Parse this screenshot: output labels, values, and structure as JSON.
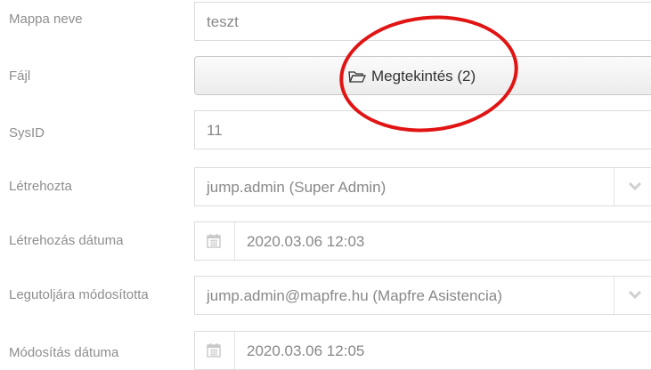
{
  "form": {
    "folder_name": {
      "label": "Mappa neve",
      "value": "teszt"
    },
    "file": {
      "label": "Fájl",
      "button_label": "Megtekintés (2)"
    },
    "sysid": {
      "label": "SysID",
      "value": "11"
    },
    "created_by": {
      "label": "Létrehozta",
      "value": "jump.admin (Super Admin)"
    },
    "created_at": {
      "label": "Létrehozás dátuma",
      "value": "2020.03.06 12:03"
    },
    "modified_by": {
      "label": "Legutoljára módosította",
      "value": "jump.admin@mapfre.hu (Mapfre Asistencia)"
    },
    "modified_at": {
      "label": "Módosítás dátuma",
      "value": "2020.03.06 12:05"
    }
  },
  "icons": {
    "folder": "folder-open-icon",
    "chevron": "chevron-down-icon",
    "calendar": "calendar-icon"
  },
  "colors": {
    "highlight_ring": "#e11414",
    "label": "#8e8e8e",
    "value": "#888888"
  }
}
